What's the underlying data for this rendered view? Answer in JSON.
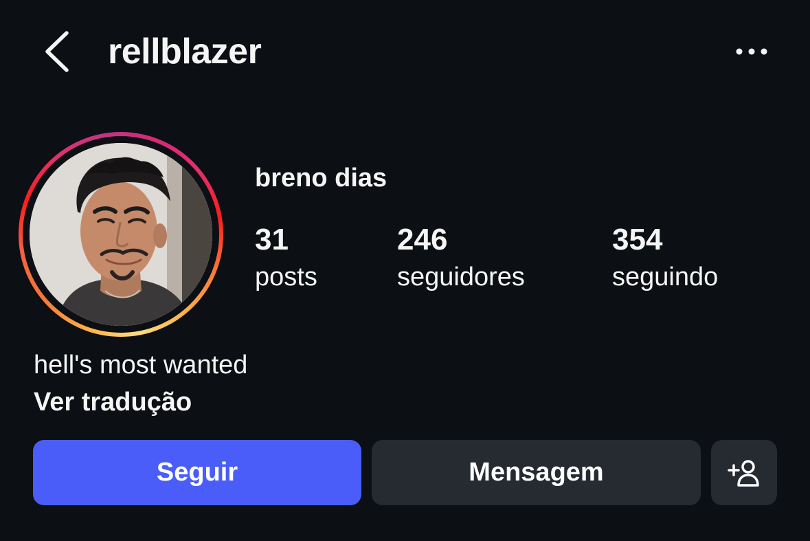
{
  "header": {
    "username": "rellblazer",
    "back_icon": "chevron-left-icon",
    "more_icon": "more-horizontal-icon"
  },
  "profile": {
    "display_name": "breno dias",
    "avatar": "profile-photo",
    "story_ring_colors": [
      "#fcaf45",
      "#fd1d1d",
      "#e1306c",
      "#c13584"
    ]
  },
  "stats": [
    {
      "value": "31",
      "label": "posts"
    },
    {
      "value": "246",
      "label": "seguidores"
    },
    {
      "value": "354",
      "label": "seguindo"
    }
  ],
  "bio": {
    "text": "hell's most wanted",
    "translate_label": "Ver tradução"
  },
  "actions": {
    "follow_label": "Seguir",
    "message_label": "Mensagem",
    "add_user_icon": "add-person-icon",
    "follow_color": "#4a5df9",
    "secondary_color": "#262a31"
  }
}
